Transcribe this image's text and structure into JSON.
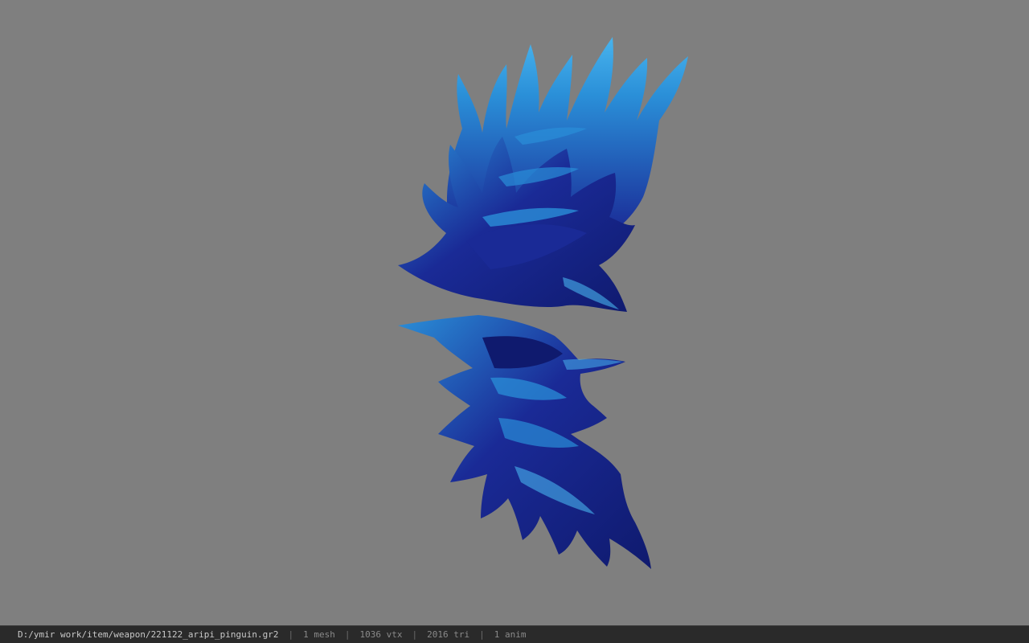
{
  "viewport": {
    "background": "#7f7f7f",
    "model_colors": {
      "base": "#1a2a96",
      "dark": "#0f1a6e",
      "highlight": "#2a8fd8",
      "light": "#48b4ee"
    }
  },
  "status_bar": {
    "file_path": "D:/ymir work/item/weapon/221122_aripi_pinguin.gr2",
    "separator": "|",
    "mesh_count": "1 mesh",
    "vertex_count": "1036 vtx",
    "triangle_count": "2016 tri",
    "anim_count": "1 anim"
  }
}
